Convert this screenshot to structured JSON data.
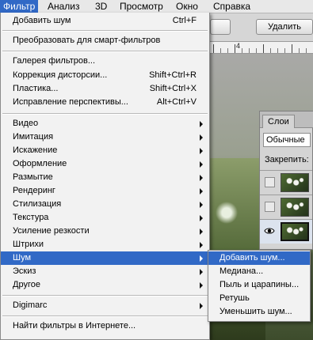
{
  "menubar": {
    "items": [
      "Фильтр",
      "Анализ",
      "3D",
      "Просмотр",
      "Окно",
      "Справка"
    ]
  },
  "options_bar": {
    "delete_label": "Удалить"
  },
  "ruler": {
    "label": "4"
  },
  "filter_menu": {
    "add_noise_last": {
      "label": "Добавить шум",
      "shortcut": "Ctrl+F"
    },
    "convert_smart": {
      "label": "Преобразовать для смарт-фильтров"
    },
    "gallery": {
      "label": "Галерея фильтров..."
    },
    "lens": {
      "label": "Коррекция дисторсии...",
      "shortcut": "Shift+Ctrl+R"
    },
    "liquify": {
      "label": "Пластика...",
      "shortcut": "Shift+Ctrl+X"
    },
    "vanishing": {
      "label": "Исправление перспективы...",
      "shortcut": "Alt+Ctrl+V"
    },
    "submenus": [
      "Видео",
      "Имитация",
      "Искажение",
      "Оформление",
      "Размытие",
      "Рендеринг",
      "Стилизация",
      "Текстура",
      "Усиление резкости",
      "Штрихи",
      "Шум",
      "Эскиз",
      "Другое"
    ],
    "digimarc": {
      "label": "Digimarc"
    },
    "browse_online": {
      "label": "Найти фильтры в Интернете..."
    }
  },
  "noise_submenu": {
    "items": [
      "Добавить шум...",
      "Медиана...",
      "Пыль и царапины...",
      "Ретушь",
      "Уменьшить шум..."
    ]
  },
  "layers_panel": {
    "tab_label": "Слои",
    "blend_mode": "Обычные",
    "lock_label": "Закрепить:"
  },
  "colors": {
    "highlight": "#3169c6",
    "menu_bg": "#f2f2f2"
  }
}
